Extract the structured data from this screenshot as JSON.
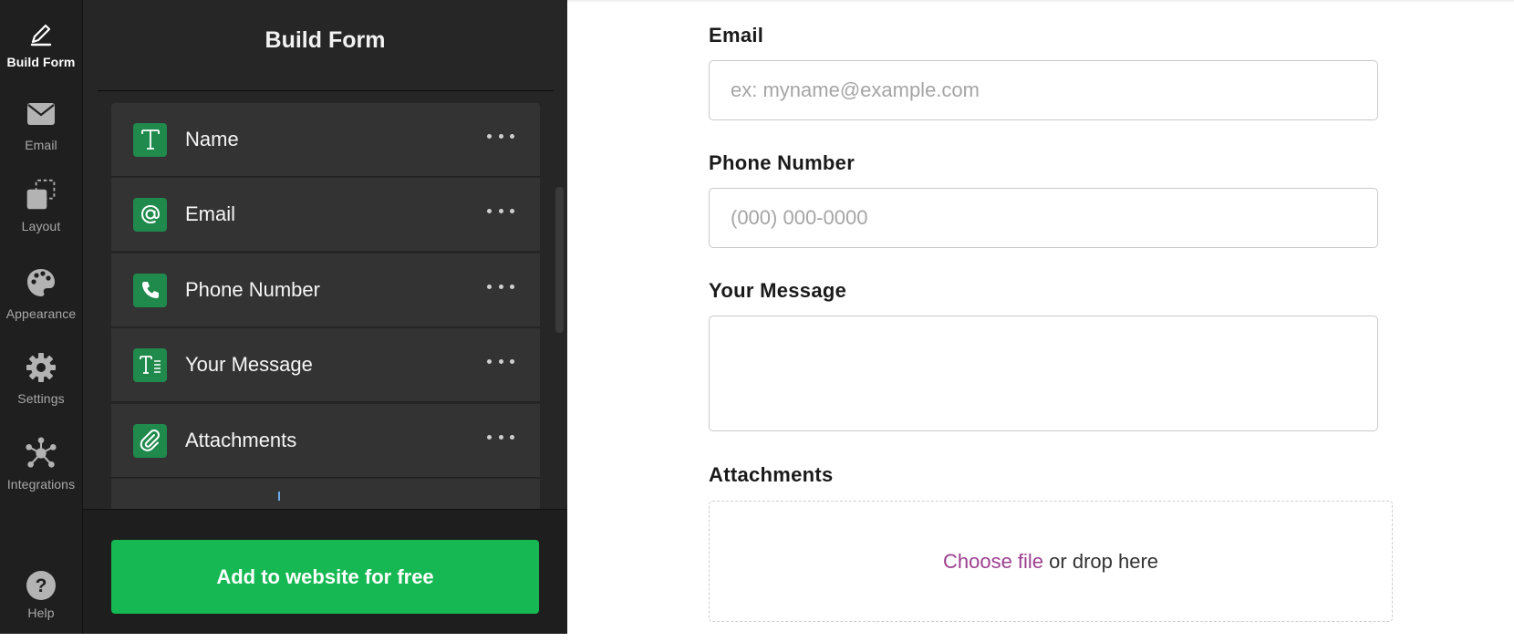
{
  "sidebar": {
    "items": [
      {
        "label": "Build Form",
        "icon": "pencil-icon",
        "active": true
      },
      {
        "label": "Email",
        "icon": "envelope-icon",
        "active": false
      },
      {
        "label": "Layout",
        "icon": "layout-icon",
        "active": false
      },
      {
        "label": "Appearance",
        "icon": "palette-icon",
        "active": false
      },
      {
        "label": "Settings",
        "icon": "gear-icon",
        "active": false
      },
      {
        "label": "Integrations",
        "icon": "integrations-icon",
        "active": false
      }
    ],
    "help_label": "Help"
  },
  "builder": {
    "title": "Build Form",
    "fields": [
      {
        "label": "Name",
        "icon": "text-icon"
      },
      {
        "label": "Email",
        "icon": "at-icon"
      },
      {
        "label": "Phone Number",
        "icon": "phone-icon"
      },
      {
        "label": "Your Message",
        "icon": "long-text-icon"
      },
      {
        "label": "Attachments",
        "icon": "paperclip-icon"
      }
    ],
    "cta_label": "Add to website for free"
  },
  "preview": {
    "email": {
      "label": "Email",
      "placeholder": "ex: myname@example.com"
    },
    "phone": {
      "label": "Phone Number",
      "placeholder": "(000) 000-0000"
    },
    "message": {
      "label": "Your Message"
    },
    "attachments": {
      "label": "Attachments",
      "choose_label": "Choose file",
      "drop_label": " or drop here"
    }
  },
  "colors": {
    "accent_green": "#15b852",
    "icon_green": "#1f8a4c",
    "link_purple": "#9c3f8f",
    "rail_bg": "#1f1f1f",
    "panel_bg": "#262626"
  }
}
